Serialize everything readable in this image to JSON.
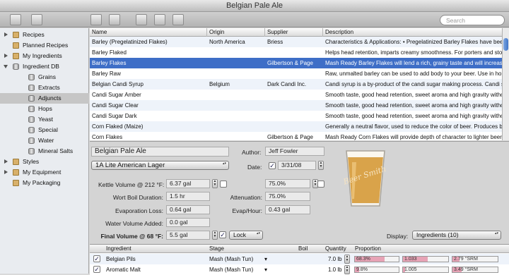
{
  "window": {
    "title": "Belgian Pale Ale"
  },
  "toolbar": {
    "buttons": [
      "new-folder-icon",
      "folder-icon",
      "add-icon",
      "remove-icon",
      "save-icon",
      "export-icon",
      "print-icon"
    ],
    "search_placeholder": "Search"
  },
  "sidebar": {
    "items": [
      {
        "label": "Recipes",
        "icon": "folder-icon",
        "level": 0,
        "expander": "collapsed"
      },
      {
        "label": "Planned Recipes",
        "icon": "document-icon",
        "level": 0,
        "expander": "none"
      },
      {
        "label": "My Ingredients",
        "icon": "folder-icon",
        "level": 0,
        "expander": "collapsed"
      },
      {
        "label": "Ingredient DB",
        "icon": "database-icon",
        "level": 0,
        "expander": "expanded"
      },
      {
        "label": "Grains",
        "icon": "database-icon",
        "level": 1,
        "expander": "none"
      },
      {
        "label": "Extracts",
        "icon": "database-icon",
        "level": 1,
        "expander": "none"
      },
      {
        "label": "Adjuncts",
        "icon": "database-icon",
        "level": 1,
        "expander": "none",
        "selected": true
      },
      {
        "label": "Hops",
        "icon": "database-icon",
        "level": 1,
        "expander": "none"
      },
      {
        "label": "Yeast",
        "icon": "database-icon",
        "level": 1,
        "expander": "none"
      },
      {
        "label": "Special",
        "icon": "database-icon",
        "level": 1,
        "expander": "none"
      },
      {
        "label": "Water",
        "icon": "database-icon",
        "level": 1,
        "expander": "none"
      },
      {
        "label": "Mineral Salts",
        "icon": "database-icon",
        "level": 1,
        "expander": "none"
      },
      {
        "label": "Styles",
        "icon": "styles-icon",
        "level": 0,
        "expander": "collapsed"
      },
      {
        "label": "My Equipment",
        "icon": "wrench-icon",
        "level": 0,
        "expander": "collapsed"
      },
      {
        "label": "My Packaging",
        "icon": "packaging-icon",
        "level": 0,
        "expander": "none"
      }
    ]
  },
  "grid": {
    "columns": [
      "Name",
      "Origin",
      "Supplier",
      "Description"
    ],
    "rows": [
      [
        "Barley (Pregelatinized Flakes)",
        "North America",
        "Briess",
        "Characteristics & Applications: • Pregelatinized Barley Flakes have been produce..."
      ],
      [
        "Barley Flaked",
        "",
        "",
        "Helps head retention, imparts creamy smoothness. For porters and stouts."
      ],
      [
        "Barley Flakes",
        "",
        "Gilbertson & Page",
        "Mash Ready Barley Flakes will lend a rich, grainy taste and will increase head ret..."
      ],
      [
        "Barley Raw",
        "",
        "",
        "Raw, unmalted barley can be used to add body to your beer. Use in homebrew ..."
      ],
      [
        "Belgian Candi Syrup",
        "Belgium",
        "Dark Candi Inc.",
        "Candi syrup is a by-product of the candi sugar making process. Candi syrup h..."
      ],
      [
        "Candi Sugar Amber",
        "",
        "",
        "Smooth taste, good head retention, sweet aroma and high gravity without bein..."
      ],
      [
        "Candi Sugar Clear",
        "",
        "",
        "Smooth taste, good head retention, sweet aroma and high gravity without bein..."
      ],
      [
        "Candi Sugar Dark",
        "",
        "",
        "Smooth taste, good head retention, sweet aroma and high gravity without bein..."
      ],
      [
        "Corn Flaked (Maize)",
        "",
        "",
        "Generally a neutral flavor, used to reduce the color of beer. Produces beer with ..."
      ],
      [
        "Corn Flakes",
        "",
        "Gilbertson & Page",
        "Mash Ready Corn Flakes will provide depth of character to lighter beers when ..."
      ]
    ],
    "selected_row": 2
  },
  "recipe": {
    "name": "Belgian Pale Ale",
    "author_label": "Author:",
    "author": "Jeff Fowler",
    "style": "1A Lite American Lager",
    "date_label": "Date:",
    "date": "3/31/08",
    "kettle_label": "Kettle Volume @ 212 °F:",
    "kettle_value": "6.37 gal",
    "efficiency_value": "75.0%",
    "boil_label": "Wort Boil Duration:",
    "boil_value": "1.5 hr",
    "attenuation_label": "Attenuation:",
    "attenuation_value": "75.0%",
    "evap_label": "Evaporation Loss:",
    "evap_value": "0.64 gal",
    "evap_hour_label": "Evap/Hour:",
    "evap_hour_value": "0.43 gal",
    "water_label": "Water Volume Added:",
    "water_value": "0.0 gal",
    "final_label": "Final Volume @ 68 °F:",
    "final_value": "5.5 gal",
    "lock_label": "Lock",
    "display_label": "Display:",
    "display_value": "Ingredients (10)",
    "glass_text": "Beer Smith"
  },
  "ingredients": {
    "columns": [
      "Ingredient",
      "Stage",
      "Boil",
      "Quantity",
      "Proportion"
    ],
    "rows": [
      {
        "name": "Belgian Pils",
        "stage": "Mash (Mash Tun)",
        "quantity": "7.0 lb",
        "proportion": "68.3%",
        "proportion_value": 0.683,
        "gravity": "1.033",
        "gravity_fill": 0.55,
        "color": "2.79 °SRM",
        "color_fill": 0.15
      },
      {
        "name": "Aromatic Malt",
        "stage": "Mash (Mash Tun)",
        "quantity": "1.0 lb",
        "proportion": "9.8%",
        "proportion_value": 0.098,
        "gravity": "1.005",
        "gravity_fill": 0.05,
        "color": "3.49 °SRM",
        "color_fill": 0.2
      }
    ]
  },
  "colors": {
    "selection": "#3e6ec7",
    "proportion_bar": "#e7a3b6",
    "beer": "#d9a34a"
  }
}
